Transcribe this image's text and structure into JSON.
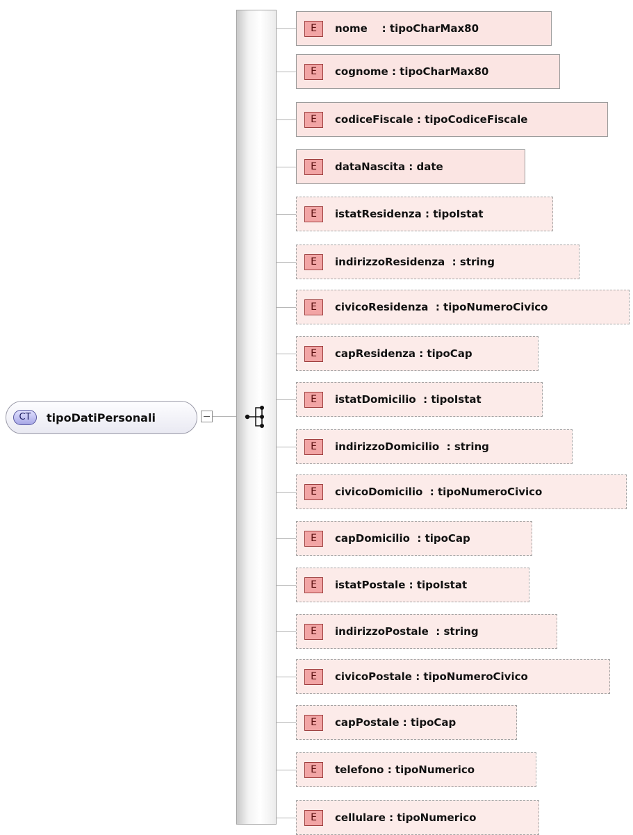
{
  "complex_type": {
    "badge": "CT",
    "name": "tipoDatiPersonali"
  },
  "elements": [
    {
      "badge": "E",
      "label": "nome    : tipoCharMax80",
      "optional": false
    },
    {
      "badge": "E",
      "label": "cognome : tipoCharMax80",
      "optional": false
    },
    {
      "badge": "E",
      "label": "codiceFiscale : tipoCodiceFiscale",
      "optional": false
    },
    {
      "badge": "E",
      "label": "dataNascita : date",
      "optional": false
    },
    {
      "badge": "E",
      "label": "istatResidenza : tipoIstat",
      "optional": true
    },
    {
      "badge": "E",
      "label": "indirizzoResidenza  : string",
      "optional": true
    },
    {
      "badge": "E",
      "label": "civicoResidenza  : tipoNumeroCivico",
      "optional": true
    },
    {
      "badge": "E",
      "label": "capResidenza : tipoCap",
      "optional": true
    },
    {
      "badge": "E",
      "label": "istatDomicilio  : tipoIstat",
      "optional": true
    },
    {
      "badge": "E",
      "label": "indirizzoDomicilio  : string",
      "optional": true
    },
    {
      "badge": "E",
      "label": "civicoDomicilio  : tipoNumeroCivico",
      "optional": true
    },
    {
      "badge": "E",
      "label": "capDomicilio  : tipoCap",
      "optional": true
    },
    {
      "badge": "E",
      "label": "istatPostale : tipoIstat",
      "optional": true
    },
    {
      "badge": "E",
      "label": "indirizzoPostale  : string",
      "optional": true
    },
    {
      "badge": "E",
      "label": "civicoPostale : tipoNumeroCivico",
      "optional": true
    },
    {
      "badge": "E",
      "label": "capPostale : tipoCap",
      "optional": true
    },
    {
      "badge": "E",
      "label": "telefono : tipoNumerico",
      "optional": true
    },
    {
      "badge": "E",
      "label": "cellulare : tipoNumerico",
      "optional": true
    }
  ],
  "colors": {
    "element_fill": "#fbe5e3",
    "element_badge": "#f2a5a5",
    "complex_type_badge": "#a7a7e6"
  },
  "icons": {
    "sequence": "sequence-compositor-icon",
    "collapse": "collapse-box-icon"
  }
}
